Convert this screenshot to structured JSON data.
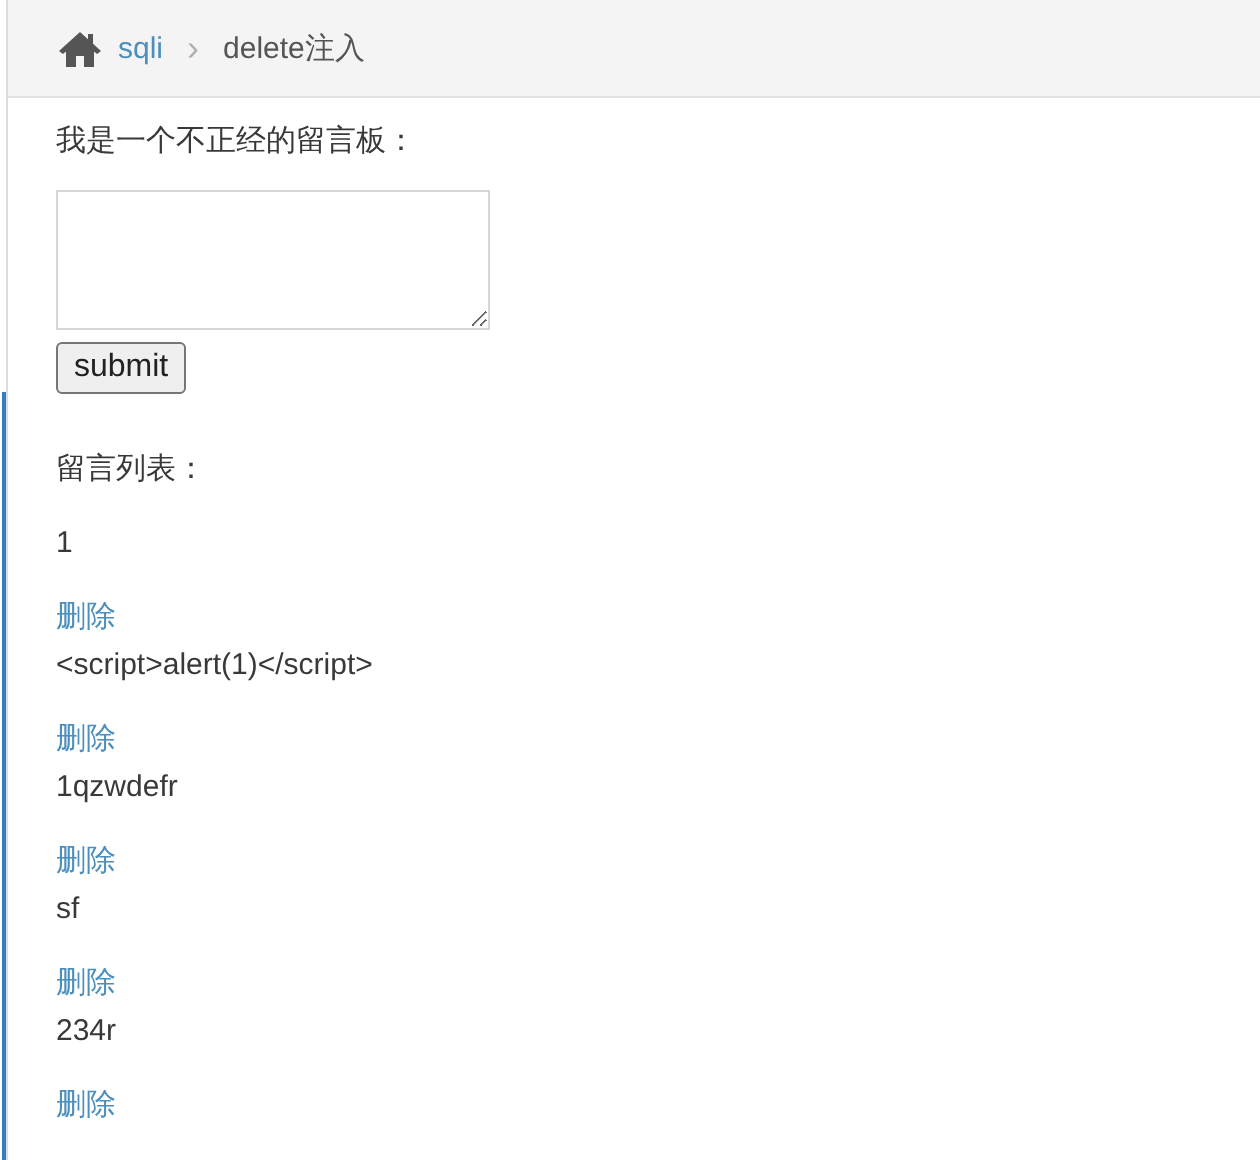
{
  "breadcrumb": {
    "parent": "sqli",
    "separator": "›",
    "current": "delete注入"
  },
  "form": {
    "label": "我是一个不正经的留言板：",
    "button": "submit"
  },
  "list": {
    "title": "留言列表：",
    "messages": [
      {
        "text": "1",
        "delete": "删除"
      },
      {
        "text": "<script>alert(1)</script>",
        "delete": "删除"
      },
      {
        "text": "1qzwdefr",
        "delete": "删除"
      },
      {
        "text": "sf",
        "delete": "删除"
      },
      {
        "text": "234r",
        "delete": "删除"
      }
    ]
  }
}
